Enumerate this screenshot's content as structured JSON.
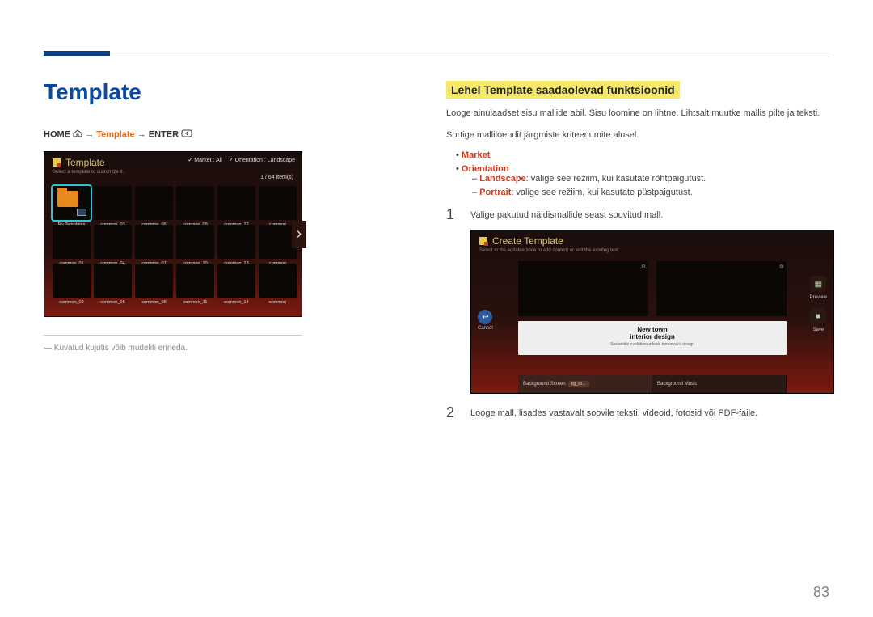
{
  "title": "Template",
  "breadcrumb": {
    "home": "HOME",
    "mid": "Template",
    "enter": "ENTER"
  },
  "template_panel": {
    "title": "Template",
    "subtitle": "Select a template to customize it.",
    "filter_market": "Market : All",
    "filter_orient": "Orientation : Landscape",
    "count": "1 / 64 item(s)",
    "cells": [
      "My Templates",
      "common_03",
      "common_06",
      "common_09",
      "common_12",
      "common",
      "common_01",
      "common_04",
      "common_07",
      "common_10",
      "common_13",
      "common",
      "common_02",
      "common_05",
      "common_08",
      "common_11",
      "common_14",
      "common"
    ]
  },
  "footnote": "Kuvatud kujutis võib mudeliti erineda.",
  "section_title": "Lehel Template saadaolevad funktsioonid",
  "para1": "Looge ainulaadset sisu mallide abil. Sisu loomine on lihtne. Lihtsalt muutke mallis pilte ja teksti.",
  "para2": "Sortige malliloendit järgmiste kriteeriumite alusel.",
  "bullets": {
    "market": "Market",
    "orientation": "Orientation",
    "landscape_label": "Landscape",
    "landscape_text": ": valige see režiim, kui kasutate rõhtpaigutust.",
    "portrait_label": "Portrait",
    "portrait_text": ": valige see režiim, kui kasutate püstpaigutust."
  },
  "steps": {
    "s1_num": "1",
    "s1_text": "Valige pakutud näidismallide seast soovitud mall.",
    "s2_num": "2",
    "s2_text": "Looge mall, lisades vastavalt soovile teksti, videoid, fotosid või PDF-faile."
  },
  "create_panel": {
    "title": "Create Template",
    "subtitle": "Select in the editable zone to add content or edit the existing text.",
    "cancel": "Cancel",
    "preview": "Preview",
    "save": "Save",
    "line1": "New  town",
    "line2": "interior  design",
    "line3": "Sustainble evolution unfolds tomorrow's design",
    "tab1": "Background Screen",
    "tab1_chip": "bg_co...",
    "tab2": "Background Music"
  },
  "page_num": "83"
}
